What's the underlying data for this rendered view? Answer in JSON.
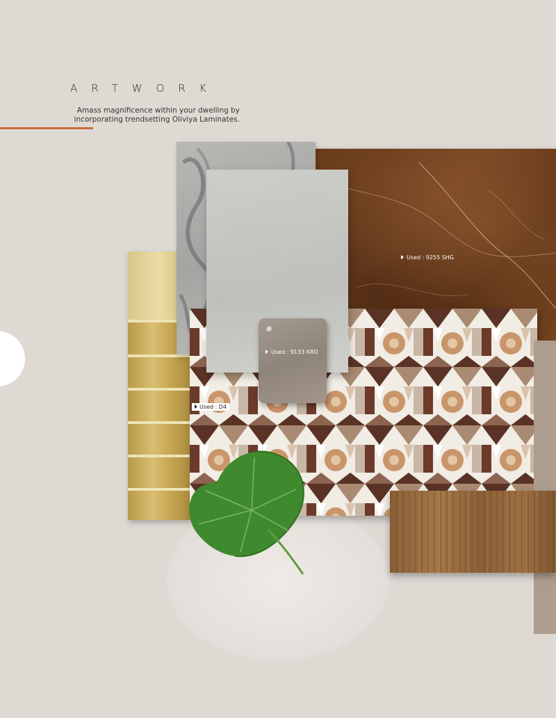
{
  "header": {
    "title": "ARTWORK",
    "tagline": "Amass magnificence within your dwelling by incorporating trendsetting Oliviya Laminates."
  },
  "swatches": {
    "marble_label": "Used : 9255 SHG",
    "chip_label": "Used : 9133 KRO",
    "pattern_label": "Used : D4"
  },
  "colors": {
    "accent_rule": "#c8693a",
    "background": "#dfd9d4",
    "marble": "#6a3c1b",
    "gold": "#c3a450",
    "wood": "#a47747",
    "leaf": "#3f8a2e"
  },
  "icons": {
    "half_circle": "half-circle-shape"
  }
}
